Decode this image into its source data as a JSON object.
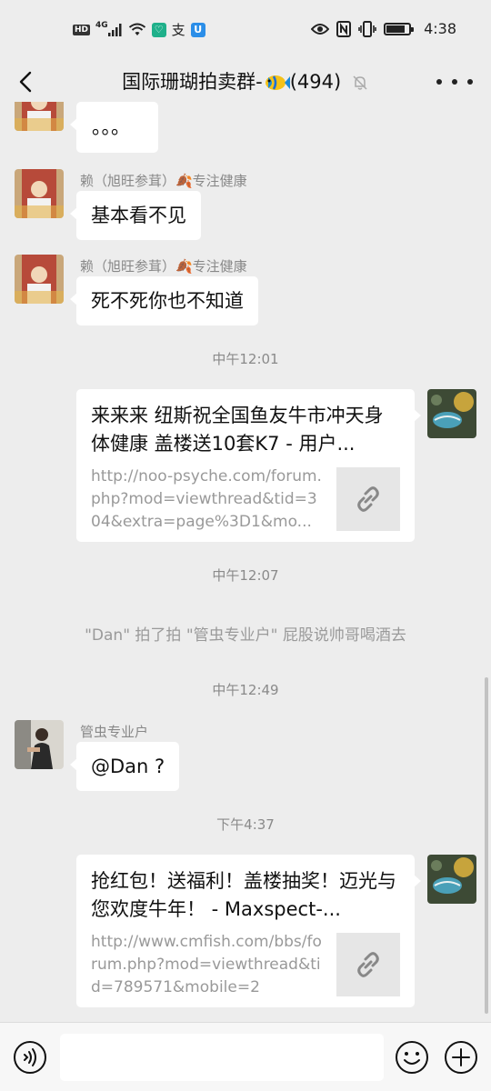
{
  "status_bar": {
    "network_badge": "HD",
    "signal_label": "4G",
    "time": "4:38",
    "battery_level": 0.85,
    "icons": [
      "signal-icon",
      "wifi-icon",
      "app-shield-icon",
      "alipay-icon",
      "app-u-icon",
      "eye-icon",
      "nfc-icon",
      "vibrate-icon",
      "battery-icon"
    ]
  },
  "header": {
    "title": "国际珊瑚拍卖群-",
    "member_count": "(494)",
    "icons": [
      "back-arrow-icon",
      "fish-icon",
      "mute-bell-icon",
      "more-dots-icon"
    ]
  },
  "messages": {
    "m0": {
      "text": "。。。"
    },
    "m1": {
      "sender": "赖（旭旺参茸）🍂专注健康",
      "text": "基本看不见"
    },
    "m2": {
      "sender": "赖（旭旺参茸）🍂专注健康",
      "text": "死不死你也不知道"
    },
    "t1": "中午12:01",
    "m3": {
      "title": "来来来 纽斯祝全国鱼友牛市冲天身体健康 盖楼送10套K7 - 用户...",
      "url": "http://noo-psyche.com/forum.php?mod=viewthread&tid=304&extra=page%3D1&mo..."
    },
    "t2": "中午12:07",
    "s1": "\"Dan\" 拍了拍 \"管虫专业户\" 屁股说帅哥喝酒去",
    "t3": "中午12:49",
    "m4": {
      "sender": "管虫专业户",
      "text": "@Dan ?"
    },
    "t4": "下午4:37",
    "m5": {
      "title": "抢红包！送福利！盖楼抽奖！迈光与您欢度牛年！ - Maxspect-...",
      "url": "http://www.cmfish.com/bbs/forum.php?mod=viewthread&tid=789571&mobile=2"
    }
  },
  "input_bar": {
    "value": "",
    "icons": [
      "voice-icon",
      "emoji-icon",
      "plus-icon"
    ]
  },
  "colors": {
    "background": "#ededed",
    "bubble": "#ffffff",
    "muted_text": "#888888"
  }
}
